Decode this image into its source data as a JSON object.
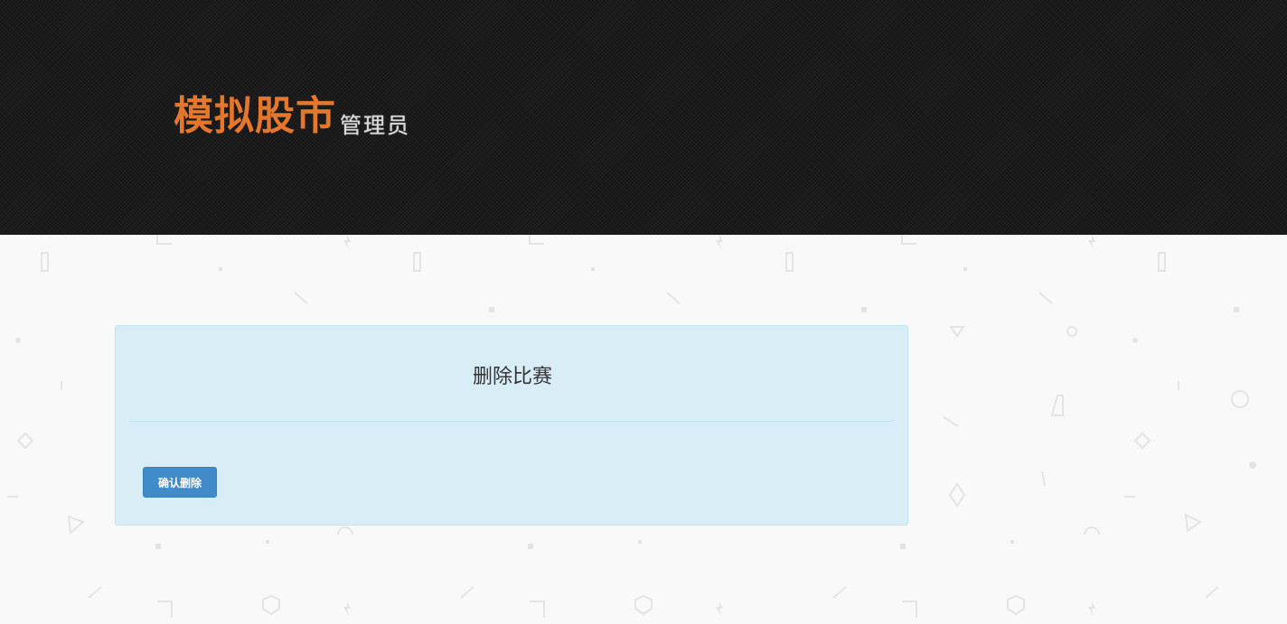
{
  "header": {
    "title": "模拟股市",
    "subtitle": "管理员"
  },
  "panel": {
    "title": "删除比赛",
    "confirm_button": "确认删除"
  },
  "colors": {
    "brand_orange": "#e5772c",
    "header_bg": "#1b1b1b",
    "panel_bg": "#d9edf7",
    "button_blue": "#428bca"
  }
}
